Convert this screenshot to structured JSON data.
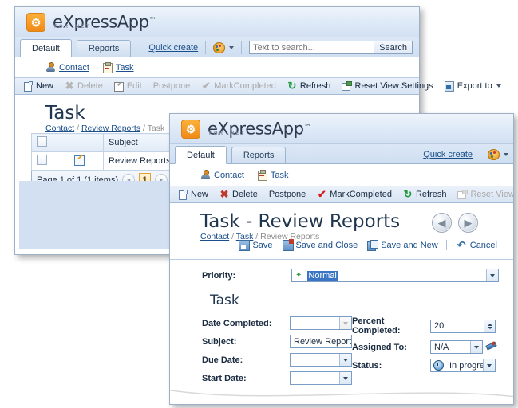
{
  "back_window": {
    "brand": {
      "name": "eXpressApp",
      "tm": "™",
      "sub": "FOR .NET",
      "logo_icon": "gear-logo-icon"
    },
    "tabs": [
      {
        "label": "Default",
        "active": true
      },
      {
        "label": "Reports",
        "active": false
      }
    ],
    "quick_create": "Quick create",
    "palette_icon": "palette-icon",
    "search": {
      "placeholder": "Text to search...",
      "value": "",
      "button": "Search"
    },
    "nav_links": [
      {
        "label": "Contact",
        "icon": "contact-icon"
      },
      {
        "label": "Task",
        "icon": "task-clipboard-icon"
      }
    ],
    "toolbar": [
      {
        "label": "New",
        "icon": "new-document-icon",
        "disabled": false
      },
      {
        "label": "Delete",
        "icon": "delete-x-icon",
        "disabled": true
      },
      {
        "label": "Edit",
        "icon": "edit-pencil-icon",
        "disabled": true
      },
      {
        "label": "Postpone",
        "icon": "",
        "disabled": true
      },
      {
        "label": "MarkCompleted",
        "icon": "check-icon",
        "disabled": true
      },
      {
        "label": "Refresh",
        "icon": "refresh-icon",
        "disabled": false
      },
      {
        "label": "Reset View Settings",
        "icon": "reset-view-icon",
        "disabled": false
      },
      {
        "label": "Export to",
        "icon": "export-icon",
        "disabled": false,
        "has_caret": true
      }
    ],
    "page_title": "Task",
    "breadcrumb": [
      {
        "label": "Contact",
        "link": true
      },
      {
        "label": "/",
        "link": false
      },
      {
        "label": "Review Reports",
        "link": true
      },
      {
        "label": "/",
        "link": false
      },
      {
        "label": "Task",
        "link": false
      }
    ],
    "grid": {
      "columns": [
        "",
        "",
        "Subject"
      ],
      "rows": [
        {
          "checked": false,
          "edit_icon": "row-edit-icon",
          "subject": "Review Reports"
        }
      ]
    },
    "pager": {
      "text": "Page 1 of 1 (1 items)",
      "prev": "◂",
      "page": "1",
      "next": "▸"
    }
  },
  "front_window": {
    "brand": {
      "name": "eXpressApp",
      "tm": "™",
      "sub": "FOR .NET",
      "logo_icon": "gear-logo-icon"
    },
    "tabs": [
      {
        "label": "Default",
        "active": true
      },
      {
        "label": "Reports",
        "active": false
      }
    ],
    "quick_create": "Quick create",
    "palette_icon": "palette-icon",
    "nav_links": [
      {
        "label": "Contact",
        "icon": "contact-icon"
      },
      {
        "label": "Task",
        "icon": "task-clipboard-icon"
      }
    ],
    "toolbar": [
      {
        "label": "New",
        "icon": "new-document-icon",
        "disabled": false
      },
      {
        "label": "Delete",
        "icon": "delete-x-icon",
        "disabled": false
      },
      {
        "label": "Postpone",
        "icon": "",
        "disabled": false
      },
      {
        "label": "MarkCompleted",
        "icon": "check-icon",
        "disabled": false
      },
      {
        "label": "Refresh",
        "icon": "refresh-icon",
        "disabled": false
      },
      {
        "label": "Reset View Settings",
        "icon": "reset-view-icon",
        "disabled": true
      }
    ],
    "page_title": "Task - Review Reports",
    "breadcrumb": [
      {
        "label": "Contact",
        "link": true
      },
      {
        "label": "/",
        "link": false
      },
      {
        "label": "Task",
        "link": true
      },
      {
        "label": "/",
        "link": false
      },
      {
        "label": "Review Reports",
        "link": false
      }
    ],
    "nav_buttons": [
      {
        "name": "back-button",
        "glyph": "◀"
      },
      {
        "name": "forward-button",
        "glyph": "▶"
      }
    ],
    "actions": [
      {
        "label": "Save",
        "icon": "save-icon"
      },
      {
        "label": "Save and Close",
        "icon": "save-and-close-icon"
      },
      {
        "label": "Save and New",
        "icon": "save-and-new-icon"
      },
      {
        "label": "Cancel",
        "icon": "cancel-undo-icon"
      }
    ],
    "priority": {
      "label": "Priority:",
      "value": "Normal",
      "bullet": "✦",
      "selected": true
    },
    "section_title": "Task",
    "fields_left": [
      {
        "label": "Date Completed:",
        "value": "",
        "control": "datepicker",
        "disabled": true
      },
      {
        "label": "Subject:",
        "value": "Review Reports",
        "control": "text"
      },
      {
        "label": "Due Date:",
        "value": "",
        "control": "datepicker"
      },
      {
        "label": "Start Date:",
        "value": "",
        "control": "datepicker"
      }
    ],
    "fields_right": [
      {
        "label": "Percent Completed:",
        "value": "20",
        "control": "spinner"
      },
      {
        "label": "Assigned To:",
        "value": "N/A",
        "control": "lookup"
      },
      {
        "label": "Status:",
        "value": "In progres",
        "control": "combo",
        "icon": "clock-icon"
      }
    ]
  },
  "colors": {
    "brand_orange": "#f18a16",
    "link_blue": "#1a4f8a",
    "chrome_blue": "#d2e0f2",
    "selection_blue": "#3a74c4",
    "panel_blue": "#d3e0f2",
    "border_blue": "#9db4d0"
  }
}
